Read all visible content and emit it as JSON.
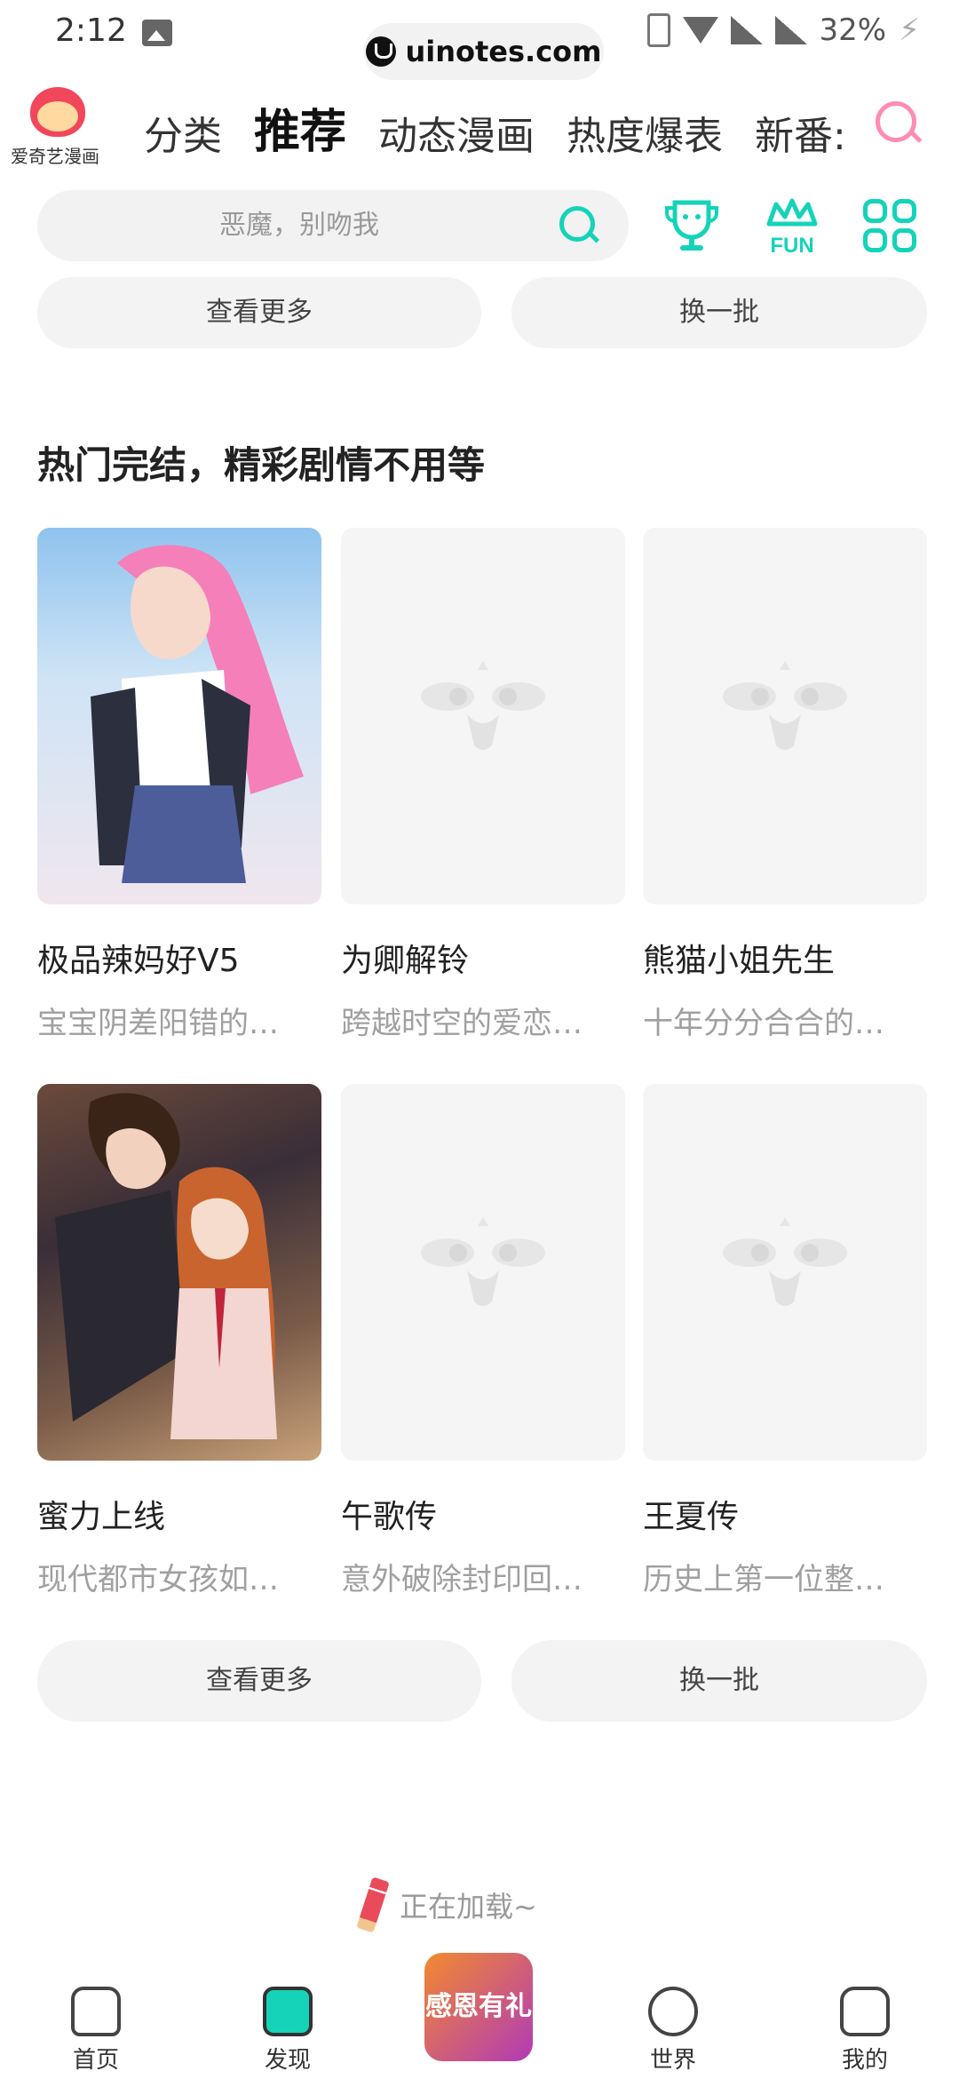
{
  "status_bar": {
    "time": "2:12",
    "url": "uinotes.com",
    "battery": "32%"
  },
  "header": {
    "logo_text": "爱奇艺漫画",
    "tabs": [
      {
        "label": "分类"
      },
      {
        "label": "推荐"
      },
      {
        "label": "动态漫画"
      },
      {
        "label": "热度爆表"
      },
      {
        "label": "新番:"
      }
    ]
  },
  "search": {
    "placeholder": "恶魔，别吻我"
  },
  "top_buttons": {
    "more": "查看更多",
    "refresh": "换一批"
  },
  "section": {
    "title": "热门完结，精彩剧情不用等",
    "items": [
      {
        "title": "极品辣妈好V5",
        "desc": "宝宝阴差阳错的…"
      },
      {
        "title": "为卿解铃",
        "desc": "跨越时空的爱恋…"
      },
      {
        "title": "熊猫小姐先生",
        "desc": "十年分分合合的…"
      },
      {
        "title": "蜜力上线",
        "desc": "现代都市女孩如…"
      },
      {
        "title": "午歌传",
        "desc": "意外破除封印回…"
      },
      {
        "title": "王夏传",
        "desc": "历史上第一位整…"
      }
    ],
    "more": "查看更多",
    "refresh": "换一批"
  },
  "loading_text": "正在加载~",
  "bottom_nav": {
    "home": "首页",
    "discover": "发现",
    "promo": "感恩有礼",
    "world": "世界",
    "mine": "我的"
  },
  "colors": {
    "accent": "#14d3b9",
    "brand": "#f2465a",
    "search_pink": "#ff8cb3"
  }
}
